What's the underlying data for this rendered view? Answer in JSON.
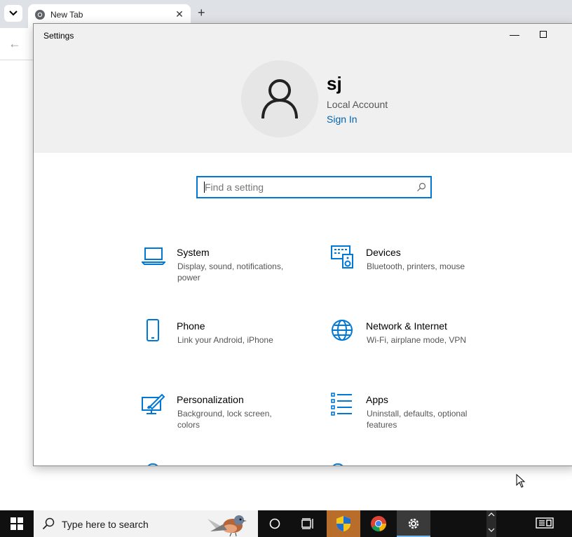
{
  "browser": {
    "tab_title": "New Tab",
    "tab_close": "✕",
    "new_tab": "+",
    "back": "←"
  },
  "settings": {
    "window_title": "Settings",
    "minimize": "—",
    "user": {
      "name": "sj",
      "account_type": "Local Account",
      "sign_in": "Sign In"
    },
    "search": {
      "placeholder": "Find a setting"
    },
    "categories": [
      {
        "title": "System",
        "desc": "Display, sound, notifications, power",
        "icon": "laptop-icon"
      },
      {
        "title": "Devices",
        "desc": "Bluetooth, printers, mouse",
        "icon": "keyboard-speaker-icon"
      },
      {
        "title": "Phone",
        "desc": "Link your Android, iPhone",
        "icon": "phone-icon"
      },
      {
        "title": "Network & Internet",
        "desc": "Wi-Fi, airplane mode, VPN",
        "icon": "globe-icon"
      },
      {
        "title": "Personalization",
        "desc": "Background, lock screen, colors",
        "icon": "paint-icon"
      },
      {
        "title": "Apps",
        "desc": "Uninstall, defaults, optional features",
        "icon": "apps-list-icon"
      }
    ]
  },
  "taskbar": {
    "search_placeholder": "Type here to search"
  },
  "colors": {
    "accent": "#0078d7",
    "link": "#0063b1",
    "header_bg": "#f0f0f0",
    "taskbar_bg": "#101010"
  }
}
